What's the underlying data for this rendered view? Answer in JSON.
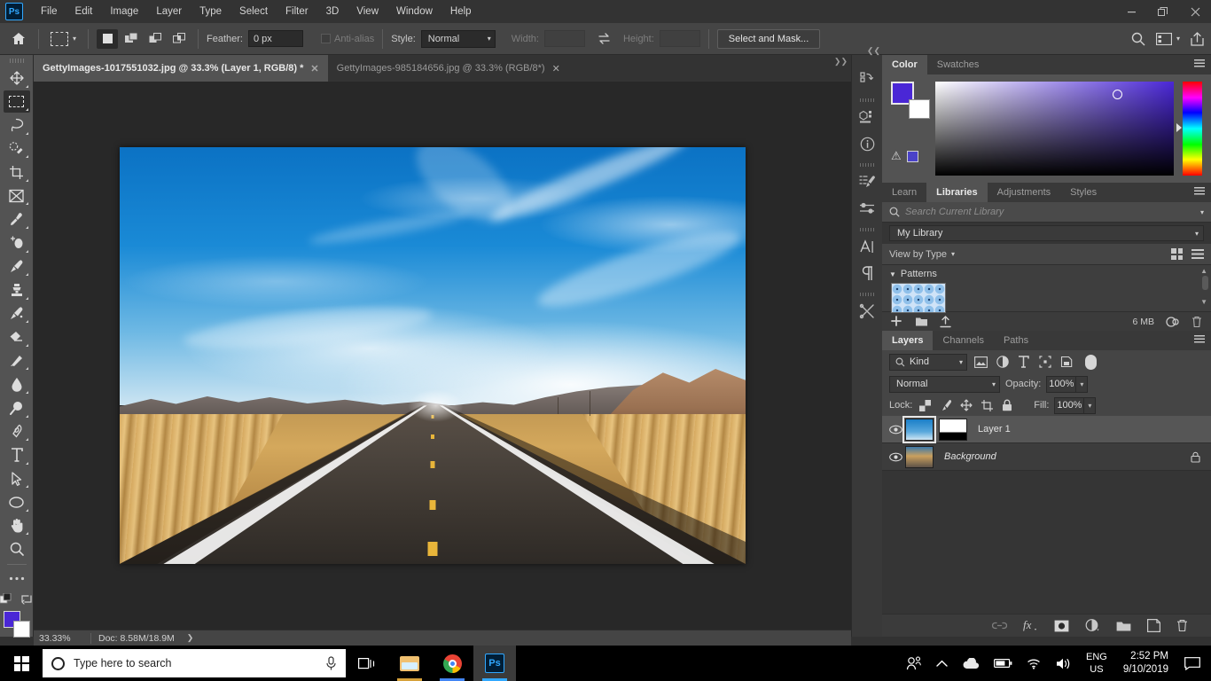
{
  "app": {
    "name": "Adobe Photoshop",
    "logo_text": "Ps"
  },
  "menubar": {
    "items": [
      "File",
      "Edit",
      "Image",
      "Layer",
      "Type",
      "Select",
      "Filter",
      "3D",
      "View",
      "Window",
      "Help"
    ]
  },
  "window_controls": {
    "minimize": "—",
    "restore": "❐",
    "close": "✕"
  },
  "options_bar": {
    "home_icon": "home-icon",
    "tool_icon": "rectangular-marquee-icon",
    "selection_modes": [
      "new-selection",
      "add-to-selection",
      "subtract-from-selection",
      "intersect-with-selection"
    ],
    "feather_label": "Feather:",
    "feather_value": "0 px",
    "antialias_label": "Anti-alias",
    "style_label": "Style:",
    "style_value": "Normal",
    "width_label": "Width:",
    "width_value": "",
    "swap_icon": "swap-width-height-icon",
    "height_label": "Height:",
    "height_value": "",
    "select_and_mask": "Select and Mask...",
    "right_icons": [
      "search-icon",
      "workspace-icon",
      "chevron-down-icon",
      "share-icon"
    ]
  },
  "tabs": [
    {
      "title": "GettyImages-1017551032.jpg @ 33.3% (Layer 1, RGB/8) *",
      "close": "✕",
      "active": true
    },
    {
      "title": "GettyImages-985184656.jpg @ 33.3% (RGB/8*)",
      "close": "✕",
      "active": false
    }
  ],
  "toolbar": {
    "tools": [
      {
        "name": "move-tool",
        "glyph": "✥"
      },
      {
        "name": "rectangular-marquee-tool",
        "glyph": "▭",
        "active": true
      },
      {
        "name": "lasso-tool",
        "glyph": "◯"
      },
      {
        "name": "quick-selection-tool",
        "glyph": "✧"
      },
      {
        "name": "crop-tool",
        "glyph": "⌗"
      },
      {
        "name": "frame-tool",
        "glyph": "⊠"
      },
      {
        "name": "eyedropper-tool",
        "glyph": "✒"
      },
      {
        "name": "spot-healing-brush-tool",
        "glyph": "✚"
      },
      {
        "name": "brush-tool",
        "glyph": "🖌"
      },
      {
        "name": "clone-stamp-tool",
        "glyph": "⎙"
      },
      {
        "name": "history-brush-tool",
        "glyph": "✎"
      },
      {
        "name": "eraser-tool",
        "glyph": "▱"
      },
      {
        "name": "gradient-tool",
        "glyph": "◨"
      },
      {
        "name": "blur-tool",
        "glyph": "💧"
      },
      {
        "name": "dodge-tool",
        "glyph": "🔍"
      },
      {
        "name": "pen-tool",
        "glyph": "✐"
      },
      {
        "name": "horizontal-type-tool",
        "glyph": "T"
      },
      {
        "name": "path-selection-tool",
        "glyph": "➤"
      },
      {
        "name": "ellipse-tool",
        "glyph": "◯"
      },
      {
        "name": "hand-tool",
        "glyph": "✋"
      },
      {
        "name": "zoom-tool",
        "glyph": "🔎"
      },
      {
        "name": "edit-toolbar-more",
        "glyph": "•••"
      }
    ],
    "foreground_color": "#4a27d6",
    "background_color": "#ffffff"
  },
  "canvas": {
    "image_description": "Desert highway under blue sky with cirrus clouds",
    "zoom": "33.3%"
  },
  "status_bar": {
    "zoom": "33.33%",
    "doc_label": "Doc: 8.58M/18.9M",
    "arrow": "❯"
  },
  "icon_rail": {
    "collapse": "❮❮",
    "icons": [
      "history-icon",
      "3d-icon",
      "info-icon",
      "brush-presets-icon",
      "brush-settings-icon",
      "character-icon",
      "paragraph-icon",
      "tools-icon"
    ]
  },
  "color_panel": {
    "tabs": [
      {
        "label": "Color",
        "active": true
      },
      {
        "label": "Swatches",
        "active": false
      }
    ],
    "foreground": "#4a27d6",
    "background": "#ffffff",
    "menu_icon": "panel-menu-icon"
  },
  "libraries_panel": {
    "tabs": [
      {
        "label": "Learn",
        "active": false
      },
      {
        "label": "Libraries",
        "active": true
      },
      {
        "label": "Adjustments",
        "active": false
      },
      {
        "label": "Styles",
        "active": false
      }
    ],
    "search_placeholder": "Search Current Library",
    "library_name": "My Library",
    "view_label": "View by Type",
    "group_title": "Patterns",
    "size_label": "6 MB",
    "footer_icons": [
      "add-icon",
      "folder-icon",
      "upload-icon",
      "cloud-sync-icon",
      "delete-icon"
    ]
  },
  "layers_panel": {
    "tabs": [
      {
        "label": "Layers",
        "active": true
      },
      {
        "label": "Channels",
        "active": false
      },
      {
        "label": "Paths",
        "active": false
      }
    ],
    "filter_label": "Kind",
    "filter_icons": [
      "pixel-layer-filter",
      "adjustment-layer-filter",
      "type-layer-filter",
      "shape-layer-filter",
      "smart-object-filter"
    ],
    "blend_mode": "Normal",
    "opacity_label": "Opacity:",
    "opacity_value": "100%",
    "lock_label": "Lock:",
    "lock_icons": [
      "lock-transparent-pixels",
      "lock-image-pixels",
      "lock-position",
      "lock-artboard",
      "lock-all"
    ],
    "fill_label": "Fill:",
    "fill_value": "100%",
    "layers": [
      {
        "name": "Layer 1",
        "visible": true,
        "selected": true,
        "has_mask": true,
        "locked": false,
        "italic": false
      },
      {
        "name": "Background",
        "visible": true,
        "selected": false,
        "has_mask": false,
        "locked": true,
        "italic": true
      }
    ],
    "footer_icons": [
      "link-layers-icon",
      "layer-style-icon",
      "layer-mask-icon",
      "adjustment-layer-icon",
      "new-group-icon",
      "new-layer-icon",
      "delete-layer-icon"
    ]
  },
  "taskbar": {
    "start_icon": "windows-start-icon",
    "search_placeholder": "Type here to search",
    "mic_icon": "microphone-icon",
    "apps": [
      {
        "name": "task-view",
        "label": "Task View"
      },
      {
        "name": "file-explorer",
        "label": "File Explorer"
      },
      {
        "name": "google-chrome",
        "label": "Google Chrome"
      },
      {
        "name": "photoshop",
        "label": "Adobe Photoshop",
        "active": true
      }
    ],
    "tray": {
      "people_icon": "people-icon",
      "chevron": "⌃",
      "onedrive_icon": "onedrive-icon",
      "battery_icon": "battery-icon",
      "wifi_icon": "wifi-icon",
      "volume_icon": "volume-icon",
      "language": "ENG",
      "region": "US",
      "time": "2:52 PM",
      "date": "9/10/2019",
      "notification_icon": "notification-icon"
    }
  }
}
